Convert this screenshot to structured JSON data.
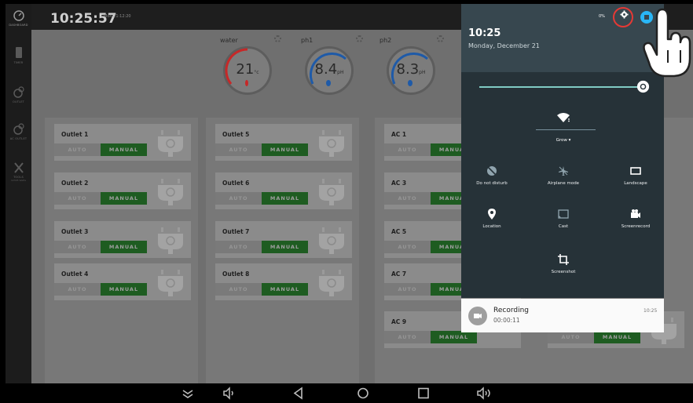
{
  "sidebar": {
    "items": [
      {
        "icon": "dashboard-icon",
        "label": "DASHBOARD"
      },
      {
        "icon": "tablet-icon",
        "label": "TIMER"
      },
      {
        "icon": "outlet-icon",
        "label": "OUTLET"
      },
      {
        "icon": "ac-icon",
        "label": "AC OUTLET"
      },
      {
        "icon": "tools-icon",
        "label": "TOOLS",
        "sub": "12345 Watts"
      }
    ]
  },
  "app": {
    "clock": "10:25:57",
    "date": "Mon 21:12:20",
    "sensors": [
      {
        "name": "water",
        "value": "21",
        "unit": "°c",
        "ring_color": "#c62828"
      },
      {
        "name": "ph1",
        "value": "8.4",
        "unit": "pH",
        "ring_color": "#1e5aa8"
      },
      {
        "name": "ph2",
        "value": "8.3",
        "unit": "pH",
        "ring_color": "#1e5aa8"
      }
    ],
    "auto_label": "AUTO",
    "manual_label": "MANUAL",
    "columns": [
      {
        "outlets": [
          "Outlet 1",
          "Outlet 2",
          "Outlet 3",
          "Outlet 4"
        ]
      },
      {
        "outlets": [
          "Outlet 5",
          "Outlet 6",
          "Outlet 7",
          "Outlet 8"
        ]
      },
      {
        "outlets": [
          "AC 1",
          "AC 3",
          "AC 5",
          "AC 7",
          "AC 9"
        ]
      }
    ]
  },
  "shade": {
    "time": "10:25",
    "date": "Monday, December 21",
    "battery": "0%",
    "brightness": 1.0,
    "wifi_label": "Grow",
    "tiles": [
      {
        "icon": "do-not-disturb-icon",
        "label": "Do not disturb"
      },
      {
        "icon": "airplane-mode-icon",
        "label": "Airplane mode"
      },
      {
        "icon": "landscape-icon",
        "label": "Landscape"
      },
      {
        "icon": "location-icon",
        "label": "Location"
      },
      {
        "icon": "cast-icon",
        "label": "Cast"
      },
      {
        "icon": "screenrecord-icon",
        "label": "Screenrecord"
      },
      {
        "icon": "screenshot-icon",
        "label": "Screenshot"
      }
    ]
  },
  "notification": {
    "title": "Recording",
    "elapsed": "00:00:11",
    "time": "10:25"
  },
  "colors": {
    "shade_bg": "#263238",
    "shade_header": "#37474f",
    "accent_teal": "#80cbc4",
    "highlight_red": "#e53935",
    "manual_green": "#1e5c21"
  }
}
